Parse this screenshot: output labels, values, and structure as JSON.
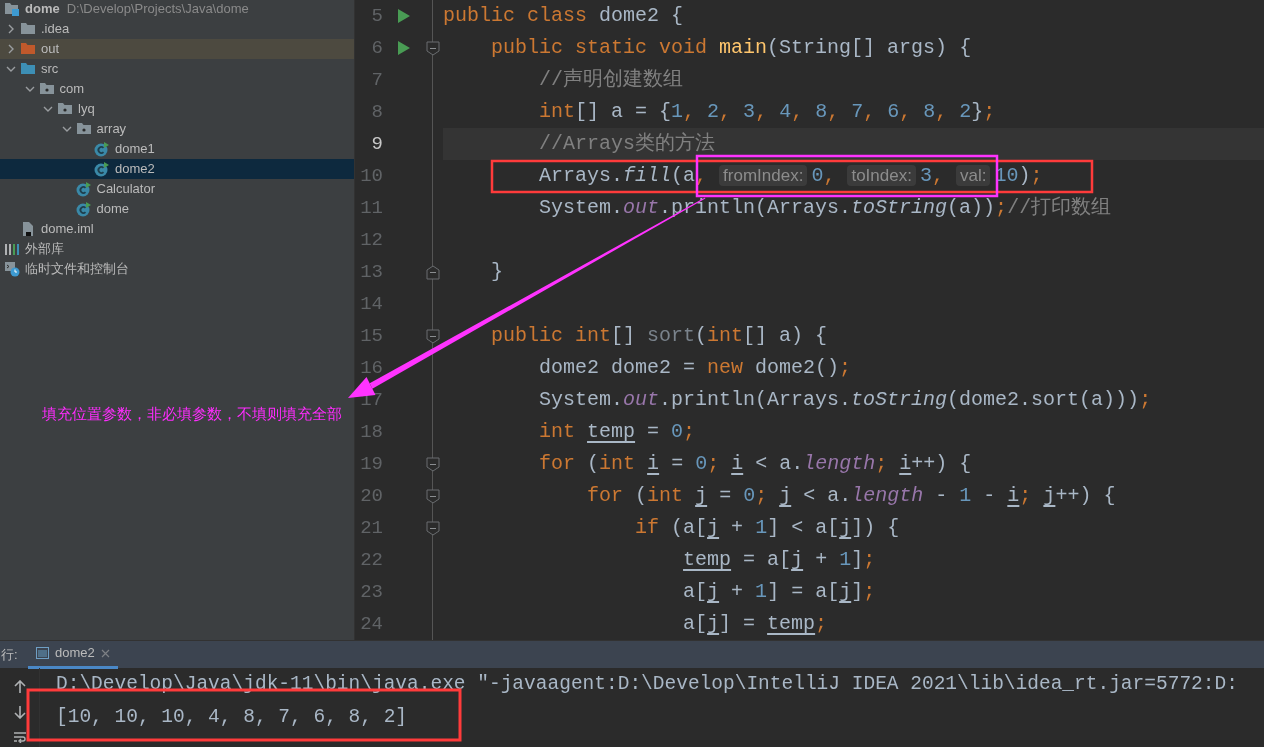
{
  "project_tree": [
    {
      "label": "dome",
      "path": "D:\\Develop\\Projects\\Java\\dome",
      "kind": "module",
      "selected": false,
      "children": [
        {
          "label": ".idea",
          "kind": "folder",
          "expanded": false,
          "selected": false
        },
        {
          "label": "out",
          "kind": "excluded-folder",
          "expanded": false,
          "selected": false
        },
        {
          "label": "src",
          "kind": "source-folder",
          "expanded": true,
          "selected": false,
          "children": [
            {
              "label": "com",
              "kind": "package",
              "expanded": true,
              "selected": false,
              "children": [
                {
                  "label": "lyq",
                  "kind": "package",
                  "expanded": true,
                  "selected": false,
                  "children": [
                    {
                      "label": "array",
                      "kind": "package",
                      "expanded": true,
                      "selected": false,
                      "children": [
                        {
                          "label": "dome1",
                          "kind": "class",
                          "selected": false
                        },
                        {
                          "label": "dome2",
                          "kind": "class",
                          "selected": true
                        }
                      ]
                    },
                    {
                      "label": "Calculator",
                      "kind": "class",
                      "selected": false
                    },
                    {
                      "label": "dome",
                      "kind": "class",
                      "selected": false
                    }
                  ]
                }
              ]
            }
          ]
        },
        {
          "label": "dome.iml",
          "kind": "file",
          "selected": false
        }
      ]
    },
    {
      "label": "外部库",
      "kind": "library",
      "selected": false
    },
    {
      "label": "临时文件和控制台",
      "kind": "scratch",
      "selected": false
    }
  ],
  "code_lines": [
    {
      "number": "5",
      "current": false,
      "gutter_icons": [
        {
          "kind": "run"
        }
      ],
      "tokens": [
        {
          "kind": "kw",
          "text": "public class"
        },
        {
          "kind": "plain",
          "text": " dome2 {"
        }
      ]
    },
    {
      "number": "6",
      "current": false,
      "gutter_icons": [
        {
          "kind": "run"
        },
        {
          "kind": "fold-start"
        }
      ],
      "tokens": [
        {
          "kind": "kw",
          "text": "    public static void"
        },
        {
          "kind": "decl",
          "text": " main"
        },
        {
          "kind": "plain",
          "text": "(String[] args) {"
        }
      ]
    },
    {
      "number": "7",
      "current": false,
      "tokens": [
        {
          "kind": "comment",
          "text": "        //声明创建数组"
        }
      ]
    },
    {
      "number": "8",
      "current": false,
      "tokens": [
        {
          "kind": "kw",
          "text": "        int"
        },
        {
          "kind": "plain",
          "text": "[] a = {"
        },
        {
          "kind": "num",
          "text": "1"
        },
        {
          "kind": "punct",
          "text": ", "
        },
        {
          "kind": "num",
          "text": "2"
        },
        {
          "kind": "punct",
          "text": ", "
        },
        {
          "kind": "num",
          "text": "3"
        },
        {
          "kind": "punct",
          "text": ", "
        },
        {
          "kind": "num",
          "text": "4"
        },
        {
          "kind": "punct",
          "text": ", "
        },
        {
          "kind": "num",
          "text": "8"
        },
        {
          "kind": "punct",
          "text": ", "
        },
        {
          "kind": "num",
          "text": "7"
        },
        {
          "kind": "punct",
          "text": ", "
        },
        {
          "kind": "num",
          "text": "6"
        },
        {
          "kind": "punct",
          "text": ", "
        },
        {
          "kind": "num",
          "text": "8"
        },
        {
          "kind": "punct",
          "text": ", "
        },
        {
          "kind": "num",
          "text": "2"
        },
        {
          "kind": "plain",
          "text": "}"
        },
        {
          "kind": "punct",
          "text": ";"
        }
      ]
    },
    {
      "number": "9",
      "current": true,
      "tokens": [
        {
          "kind": "comment",
          "text": "        //Arrays类的方法"
        }
      ]
    },
    {
      "number": "10",
      "current": false,
      "tokens": [
        {
          "kind": "plain",
          "text": "        Arrays."
        },
        {
          "kind": "static",
          "text": "fill"
        },
        {
          "kind": "plain",
          "text": "(a"
        },
        {
          "kind": "punct",
          "text": ", "
        },
        {
          "kind": "hint",
          "text": "fromIndex:"
        },
        {
          "kind": "num",
          "text": "0"
        },
        {
          "kind": "punct",
          "text": ", "
        },
        {
          "kind": "hint",
          "text": "toIndex:"
        },
        {
          "kind": "num",
          "text": "3"
        },
        {
          "kind": "punct",
          "text": ", "
        },
        {
          "kind": "hint",
          "text": "val:"
        },
        {
          "kind": "num",
          "text": "10"
        },
        {
          "kind": "plain",
          "text": ")"
        },
        {
          "kind": "punct",
          "text": ";"
        }
      ]
    },
    {
      "number": "11",
      "current": false,
      "tokens": [
        {
          "kind": "plain",
          "text": "        System."
        },
        {
          "kind": "field",
          "text": "out"
        },
        {
          "kind": "plain",
          "text": ".println(Arrays."
        },
        {
          "kind": "static",
          "text": "toString"
        },
        {
          "kind": "plain",
          "text": "(a))"
        },
        {
          "kind": "punct",
          "text": ";"
        },
        {
          "kind": "comment",
          "text": "//打印数组"
        }
      ]
    },
    {
      "number": "12",
      "current": false
    },
    {
      "number": "13",
      "current": false,
      "gutter_icons": [
        {
          "kind": "fold-end"
        }
      ],
      "tokens": [
        {
          "kind": "plain",
          "text": "    }"
        }
      ]
    },
    {
      "number": "14",
      "current": false
    },
    {
      "number": "15",
      "current": false,
      "gutter_icons": [
        {
          "kind": "fold-start"
        }
      ],
      "tokens": [
        {
          "kind": "kw",
          "text": "    public int"
        },
        {
          "kind": "plain",
          "text": "[] "
        },
        {
          "kind": "unused",
          "text": "sort"
        },
        {
          "kind": "plain",
          "text": "("
        },
        {
          "kind": "kw",
          "text": "int"
        },
        {
          "kind": "plain",
          "text": "[] a) {"
        }
      ]
    },
    {
      "number": "16",
      "current": false,
      "tokens": [
        {
          "kind": "plain",
          "text": "        dome2 dome2 = "
        },
        {
          "kind": "kw",
          "text": "new"
        },
        {
          "kind": "plain",
          "text": " dome2()"
        },
        {
          "kind": "punct",
          "text": ";"
        }
      ]
    },
    {
      "number": "17",
      "current": false,
      "tokens": [
        {
          "kind": "plain",
          "text": "        System."
        },
        {
          "kind": "field",
          "text": "out"
        },
        {
          "kind": "plain",
          "text": ".println(Arrays."
        },
        {
          "kind": "static",
          "text": "toString"
        },
        {
          "kind": "plain",
          "text": "(dome2.sort(a)))"
        },
        {
          "kind": "punct",
          "text": ";"
        }
      ]
    },
    {
      "number": "18",
      "current": false,
      "tokens": [
        {
          "kind": "kw",
          "text": "        int"
        },
        {
          "kind": "var",
          "text": " temp"
        },
        {
          "kind": "plain",
          "text": " = "
        },
        {
          "kind": "num",
          "text": "0"
        },
        {
          "kind": "punct",
          "text": ";"
        }
      ]
    },
    {
      "number": "19",
      "current": false,
      "gutter_icons": [
        {
          "kind": "fold-start"
        }
      ],
      "tokens": [
        {
          "kind": "kw",
          "text": "        for"
        },
        {
          "kind": "plain",
          "text": " ("
        },
        {
          "kind": "kw",
          "text": "int"
        },
        {
          "kind": "var",
          "text": " i"
        },
        {
          "kind": "plain",
          "text": " = "
        },
        {
          "kind": "num",
          "text": "0"
        },
        {
          "kind": "punct",
          "text": "; "
        },
        {
          "kind": "var",
          "text": "i"
        },
        {
          "kind": "plain",
          "text": " < a."
        },
        {
          "kind": "field",
          "text": "length"
        },
        {
          "kind": "punct",
          "text": "; "
        },
        {
          "kind": "var",
          "text": "i"
        },
        {
          "kind": "plain",
          "text": "++) {"
        }
      ]
    },
    {
      "number": "20",
      "current": false,
      "gutter_icons": [
        {
          "kind": "fold-start"
        }
      ],
      "tokens": [
        {
          "kind": "kw",
          "text": "            for"
        },
        {
          "kind": "plain",
          "text": " ("
        },
        {
          "kind": "kw",
          "text": "int"
        },
        {
          "kind": "var",
          "text": " j"
        },
        {
          "kind": "plain",
          "text": " = "
        },
        {
          "kind": "num",
          "text": "0"
        },
        {
          "kind": "punct",
          "text": "; "
        },
        {
          "kind": "var",
          "text": "j"
        },
        {
          "kind": "plain",
          "text": " < a."
        },
        {
          "kind": "field",
          "text": "length"
        },
        {
          "kind": "plain",
          "text": " - "
        },
        {
          "kind": "num",
          "text": "1"
        },
        {
          "kind": "plain",
          "text": " - "
        },
        {
          "kind": "var",
          "text": "i"
        },
        {
          "kind": "punct",
          "text": "; "
        },
        {
          "kind": "var",
          "text": "j"
        },
        {
          "kind": "plain",
          "text": "++) {"
        }
      ]
    },
    {
      "number": "21",
      "current": false,
      "gutter_icons": [
        {
          "kind": "fold-start"
        }
      ],
      "tokens": [
        {
          "kind": "kw",
          "text": "                if"
        },
        {
          "kind": "plain",
          "text": " (a["
        },
        {
          "kind": "var",
          "text": "j"
        },
        {
          "kind": "plain",
          "text": " + "
        },
        {
          "kind": "num",
          "text": "1"
        },
        {
          "kind": "plain",
          "text": "] < a["
        },
        {
          "kind": "var",
          "text": "j"
        },
        {
          "kind": "plain",
          "text": "]) {"
        }
      ]
    },
    {
      "number": "22",
      "current": false,
      "tokens": [
        {
          "kind": "var",
          "text": "                    temp"
        },
        {
          "kind": "plain",
          "text": " = a["
        },
        {
          "kind": "var",
          "text": "j"
        },
        {
          "kind": "plain",
          "text": " + "
        },
        {
          "kind": "num",
          "text": "1"
        },
        {
          "kind": "plain",
          "text": "]"
        },
        {
          "kind": "punct",
          "text": ";"
        }
      ]
    },
    {
      "number": "23",
      "current": false,
      "tokens": [
        {
          "kind": "plain",
          "text": "                    a["
        },
        {
          "kind": "var",
          "text": "j"
        },
        {
          "kind": "plain",
          "text": " + "
        },
        {
          "kind": "num",
          "text": "1"
        },
        {
          "kind": "plain",
          "text": "] = a["
        },
        {
          "kind": "var",
          "text": "j"
        },
        {
          "kind": "plain",
          "text": "]"
        },
        {
          "kind": "punct",
          "text": ";"
        }
      ]
    },
    {
      "number": "24",
      "current": false,
      "tokens": [
        {
          "kind": "plain",
          "text": "                    a["
        },
        {
          "kind": "var",
          "text": "j"
        },
        {
          "kind": "plain",
          "text": "] = "
        },
        {
          "kind": "var",
          "text": "temp"
        },
        {
          "kind": "punct",
          "text": ";"
        }
      ]
    }
  ],
  "annotation": {
    "text": "填充位置参数，非必填参数，不填则填充全部"
  },
  "run_panel": {
    "label": "行:",
    "tabs": [
      {
        "label": "dome2",
        "selected": true
      }
    ],
    "output": [
      "D:\\Develop\\Java\\jdk-11\\bin\\java.exe \"-javaagent:D:\\Develop\\IntelliJ IDEA 2021\\lib\\idea_rt.jar=5772:D:",
      "[10, 10, 10, 4, 8, 7, 6, 8, 2]"
    ]
  }
}
